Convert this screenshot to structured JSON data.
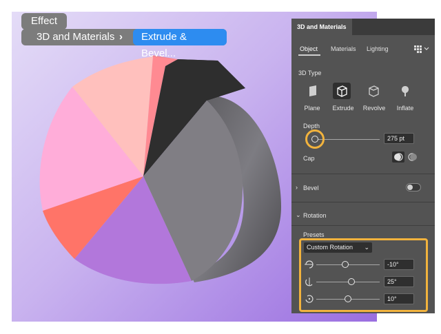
{
  "breadcrumb": {
    "effect_label": "Effect",
    "items": [
      "3D and Materials",
      "Extrude & Bevel..."
    ],
    "separator": "›"
  },
  "panel": {
    "title": "3D and Materials",
    "tabs": [
      "Object",
      "Materials",
      "Lighting"
    ],
    "active_tab": "Object",
    "type_section_label": "3D Type",
    "types": [
      "Plane",
      "Extrude",
      "Revolve",
      "Inflate"
    ],
    "selected_type": "Extrude",
    "depth_label": "Depth",
    "depth_value": "275 pt",
    "cap_label": "Cap",
    "bevel_label": "Bevel",
    "bevel_enabled": false,
    "rotation_label": "Rotation",
    "presets_label": "Presets",
    "preset_value": "Custom Rotation",
    "rotation_x": "-10°",
    "rotation_y": "25°",
    "rotation_z": "10°"
  },
  "colors": {
    "highlight": "#f2b33d",
    "panel_bg": "#535353",
    "active_crumb": "#2d8cf0",
    "pie_slices": [
      "#ffc0bd",
      "#ff8a92",
      "#2e2e2e",
      "#807e84",
      "#b277db",
      "#ff7468",
      "#ffadd9"
    ]
  },
  "icons": {
    "chevron": "chevron-right-icon",
    "gear": "gear-icon",
    "plane": "plane-icon",
    "extrude": "extrude-icon",
    "revolve": "revolve-icon",
    "inflate": "inflate-icon",
    "cap_on": "cap-on-icon",
    "cap_off": "cap-off-icon"
  }
}
